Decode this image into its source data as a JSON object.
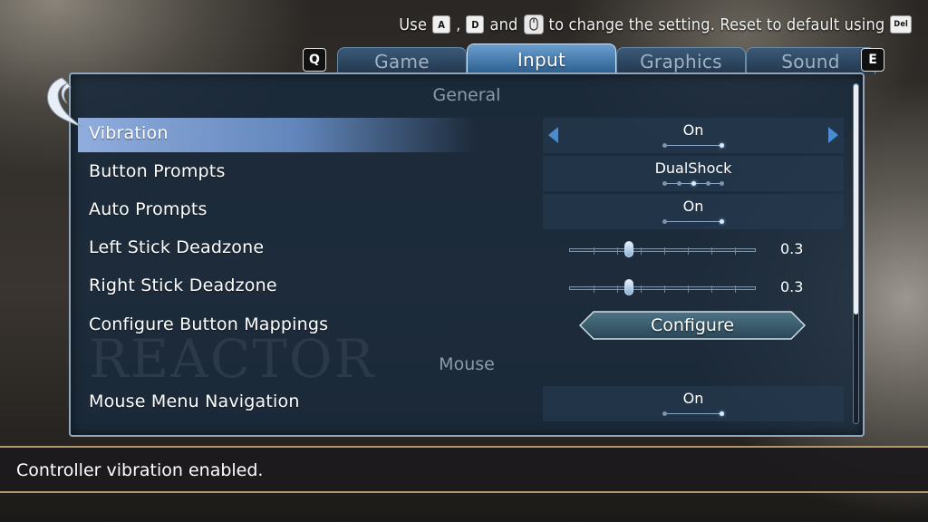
{
  "hint": {
    "use": "Use",
    "key_a": "A",
    "comma": ",",
    "key_d": "D",
    "and": "and",
    "to_change": "to change the setting. Reset to default using",
    "key_del": "Del"
  },
  "tabs": {
    "prev_key": "Q",
    "next_key": "E",
    "items": [
      {
        "label": "Game",
        "active": false
      },
      {
        "label": "Input",
        "active": true
      },
      {
        "label": "Graphics",
        "active": false
      },
      {
        "label": "Sound",
        "active": false
      }
    ]
  },
  "watermark": "REACTOR",
  "sections": {
    "general": "General",
    "mouse": "Mouse"
  },
  "settings": [
    {
      "label": "Vibration",
      "type": "toggle",
      "value": "On",
      "selected": true
    },
    {
      "label": "Button Prompts",
      "type": "select",
      "value": "DualShock"
    },
    {
      "label": "Auto Prompts",
      "type": "toggle",
      "value": "On"
    },
    {
      "label": "Left Stick Deadzone",
      "type": "slider",
      "value": "0.3",
      "fraction": 0.3
    },
    {
      "label": "Right Stick Deadzone",
      "type": "slider",
      "value": "0.3",
      "fraction": 0.3
    },
    {
      "label": "Configure Button Mappings",
      "type": "button",
      "button_label": "Configure"
    },
    {
      "label": "Mouse Menu Navigation",
      "type": "toggle",
      "value": "On"
    }
  ],
  "status": "Controller vibration enabled.",
  "colors": {
    "accent": "#4a8cd4",
    "panel": "#182a3c",
    "status_border": "#b0986a"
  }
}
